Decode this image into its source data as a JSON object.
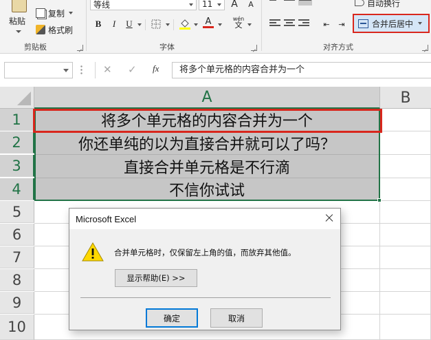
{
  "clipboard": {
    "paste_label": "粘贴",
    "copy_label": "复制",
    "format_painter_label": "格式刷",
    "group_label": "剪贴板"
  },
  "font": {
    "font_name": "等线",
    "font_size": "11",
    "bold": "B",
    "italic": "I",
    "underline": "U",
    "grow": "A",
    "shrink": "A",
    "font_color_glyph": "A",
    "phonetic": "wén",
    "group_label": "字体"
  },
  "alignment": {
    "wrap_text_label": "自动换行",
    "merge_center_label": "合并后居中",
    "group_label": "对齐方式"
  },
  "formula_bar": {
    "name_box": "",
    "cancel_glyph": "✕",
    "enter_glyph": "✓",
    "fx_label": "fx",
    "content": "将多个单元格的内容合并为一个"
  },
  "grid": {
    "columns": [
      "A",
      "B"
    ],
    "rows": [
      "1",
      "2",
      "3",
      "4",
      "5",
      "6",
      "7",
      "8",
      "9",
      "10"
    ],
    "cells": [
      "将多个单元格的内容合并为一个",
      "你还单纯的以为直接合并就可以了吗？",
      "直接合并单元格是不行滴",
      "不信你试试"
    ]
  },
  "dialog": {
    "title": "Microsoft Excel",
    "message": "合并单元格时，仅保留左上角的值，而放弃其他值。",
    "help_button": "显示帮助(E) >>",
    "ok_button": "确定",
    "cancel_button": "取消"
  },
  "colors": {
    "highlight": "#d9261c",
    "excel_green": "#217346",
    "selected_fill": "#c6c6c6"
  }
}
